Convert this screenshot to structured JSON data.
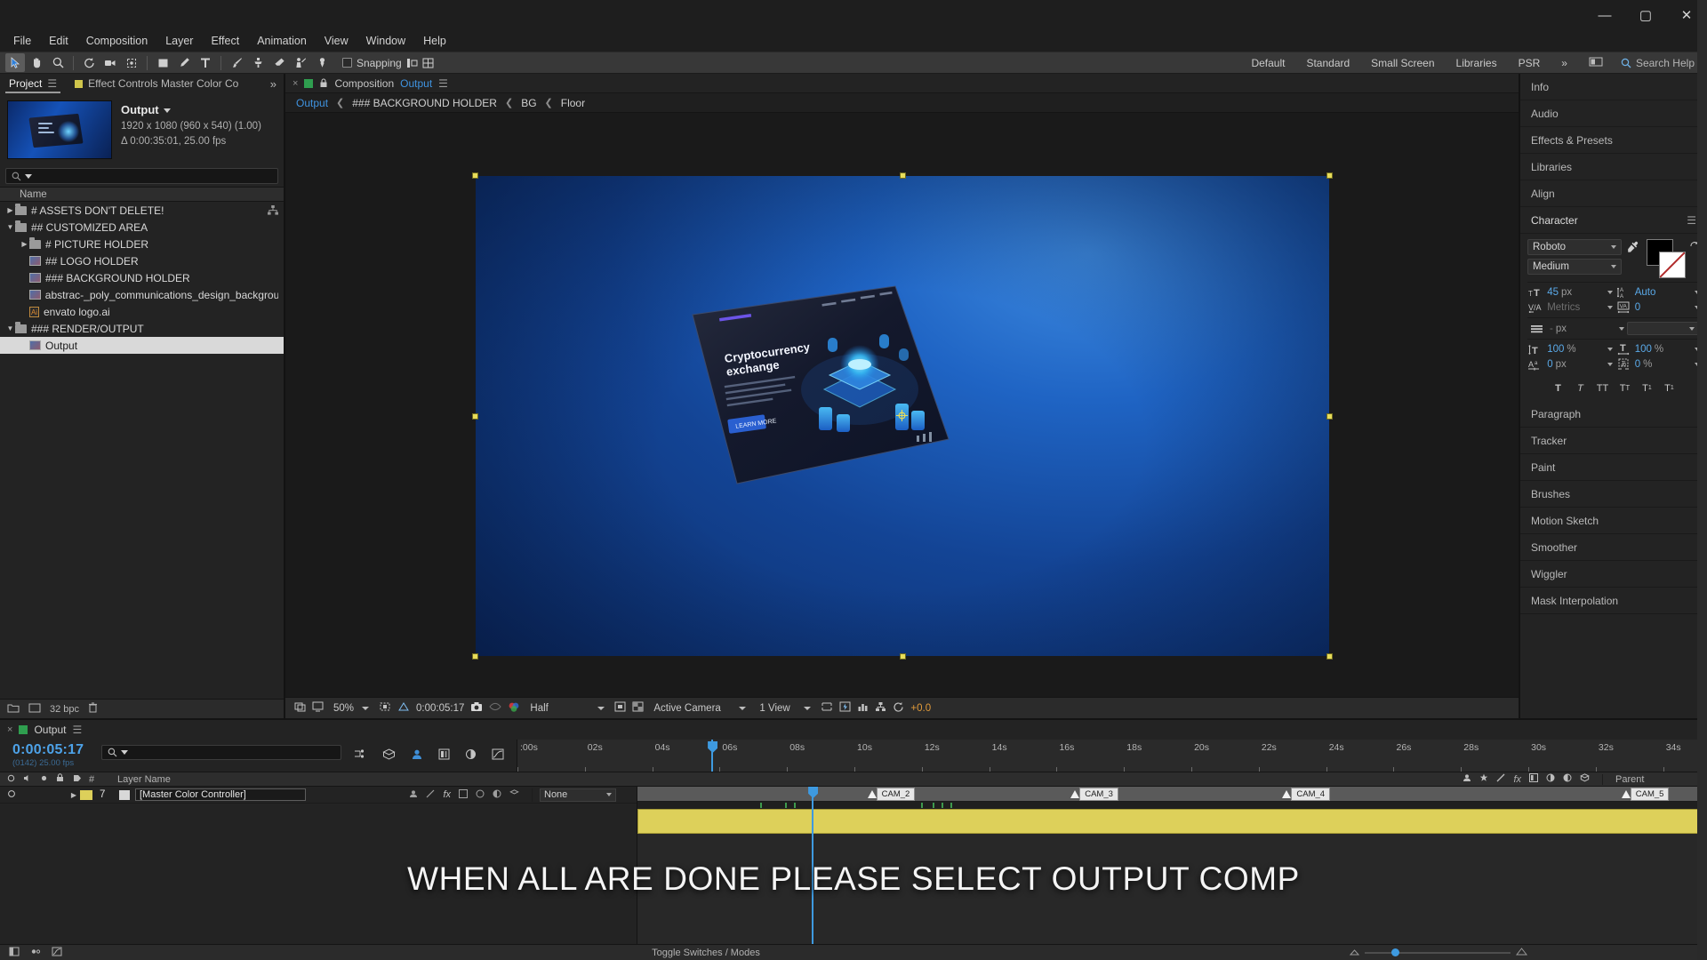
{
  "window": {
    "minimize": "—",
    "maximize": "▢",
    "close": "✕"
  },
  "menu": {
    "items": [
      "File",
      "Edit",
      "Composition",
      "Layer",
      "Effect",
      "Animation",
      "View",
      "Window",
      "Help"
    ]
  },
  "toolbar": {
    "snapping_label": "Snapping",
    "workspaces": [
      "Default",
      "Standard",
      "Small Screen",
      "Libraries",
      "PSR"
    ],
    "overflow": "»",
    "search_help": "Search Help",
    "tools": [
      "selection-tool",
      "hand-tool",
      "zoom-tool",
      "rotation-tool",
      "camera-tool",
      "anchor-point-tool",
      "shape-tool",
      "pen-tool",
      "type-tool",
      "brush-tool",
      "clone-stamp-tool",
      "eraser-tool",
      "roto-brush-tool",
      "puppet-pin-tool"
    ]
  },
  "project": {
    "tab_label": "Project",
    "effect_controls_tab": "Effect Controls Master Color Co",
    "overflow": "»",
    "item_name": "Output",
    "resolution": "1920 x 1080  (960 x 540) (1.00)",
    "duration": "Δ 0:00:35:01, 25.00 fps",
    "search_placeholder": "",
    "column_header": "Name",
    "items": [
      {
        "label": "# ASSETS DON'T DELETE!",
        "type": "folder",
        "depth": 0,
        "disclosure": "collapsed",
        "selected": false,
        "has_network_icon": true
      },
      {
        "label": "## CUSTOMIZED AREA",
        "type": "folder",
        "depth": 0,
        "disclosure": "expanded",
        "selected": false,
        "has_network_icon": false
      },
      {
        "label": "# PICTURE HOLDER",
        "type": "folder",
        "depth": 1,
        "disclosure": "collapsed",
        "selected": false,
        "has_network_icon": false
      },
      {
        "label": "## LOGO HOLDER",
        "type": "comp",
        "depth": 1,
        "disclosure": "none",
        "selected": false,
        "has_network_icon": false
      },
      {
        "label": "### BACKGROUND HOLDER",
        "type": "comp",
        "depth": 1,
        "disclosure": "none",
        "selected": false,
        "has_network_icon": false
      },
      {
        "label": "abstrac-_poly_communications_design_backgrou",
        "type": "image",
        "depth": 1,
        "disclosure": "none",
        "selected": false,
        "has_network_icon": false
      },
      {
        "label": "envato logo.ai",
        "type": "ai",
        "depth": 1,
        "disclosure": "none",
        "selected": false,
        "has_network_icon": false
      },
      {
        "label": "### RENDER/OUTPUT",
        "type": "folder",
        "depth": 0,
        "disclosure": "expanded",
        "selected": false,
        "has_network_icon": false
      },
      {
        "label": "Output",
        "type": "comp",
        "depth": 1,
        "disclosure": "none",
        "selected": true,
        "has_network_icon": false
      }
    ],
    "bpc": "32 bpc"
  },
  "composition": {
    "tab_close": "×",
    "tab_label": "Composition",
    "tab_name": "Output",
    "breadcrumb": [
      "Output",
      "### BACKGROUND HOLDER",
      "BG",
      "Floor"
    ],
    "breadcrumb_sep": "❮",
    "poster_title": "Cryptocurrency\nexchange",
    "poster_button": "LEARN MORE",
    "viewer": {
      "zoom": "50%",
      "time": "0:00:05:17",
      "resolution": "Half",
      "camera": "Active Camera",
      "views": "1 View",
      "exposure": "+0.0"
    }
  },
  "right_panel": {
    "sections": [
      "Info",
      "Audio",
      "Effects & Presets",
      "Libraries",
      "Align"
    ],
    "character": {
      "title": "Character",
      "font_family": "Roboto",
      "font_style": "Medium",
      "font_size": "45",
      "font_size_unit": "px",
      "leading": "Auto",
      "kerning": "Metrics",
      "tracking": "0",
      "stroke_width": "-",
      "stroke_unit": "px",
      "vertical_scale": "100",
      "horizontal_scale": "100",
      "percent": "%",
      "baseline_shift": "0",
      "baseline_unit": "px",
      "tsume": "0",
      "tsume_unit": "%",
      "style_buttons": [
        "T",
        "T-italic",
        "TT",
        "Tt",
        "T-superscript",
        "T-subscript"
      ]
    },
    "lower_sections": [
      "Paragraph",
      "Tracker",
      "Paint",
      "Brushes",
      "Motion Sketch",
      "Smoother",
      "Wiggler",
      "Mask Interpolation"
    ]
  },
  "timeline": {
    "tab_close": "×",
    "tab_label": "Output",
    "current_time": "0:00:05:17",
    "frame_info": "(0142) 25.00 fps",
    "search_placeholder": "",
    "columns": {
      "num": "#",
      "layer_name": "Layer Name",
      "parent": "Parent"
    },
    "layers": [
      {
        "index": "7",
        "name": "[Master Color Controller]",
        "parent": "None",
        "color": "#ddd05a"
      }
    ],
    "ruler_labels": [
      ":00s",
      "02s",
      "04s",
      "06s",
      "08s",
      "10s",
      "12s",
      "14s",
      "16s",
      "18s",
      "20s",
      "22s",
      "24s",
      "26s",
      "28s",
      "30s",
      "32s",
      "34s"
    ],
    "camera_markers": [
      {
        "label": "CAM_2",
        "time_pct": 21.5
      },
      {
        "label": "CAM_3",
        "time_pct": 40.5
      },
      {
        "label": "CAM_4",
        "time_pct": 60.3
      },
      {
        "label": "CAM_5",
        "time_pct": 92.0
      }
    ],
    "playhead_pct": 16.3,
    "toggle_switches": "Toggle Switches / Modes"
  },
  "overlay": {
    "subtitle": "WHEN ALL ARE DONE PLEASE SELECT OUTPUT COMP"
  },
  "colors": {
    "accent_blue": "#4da2e8",
    "layer_yellow": "#ddd05a",
    "panel_bg": "#232323",
    "app_bg": "#1e1e1e"
  }
}
